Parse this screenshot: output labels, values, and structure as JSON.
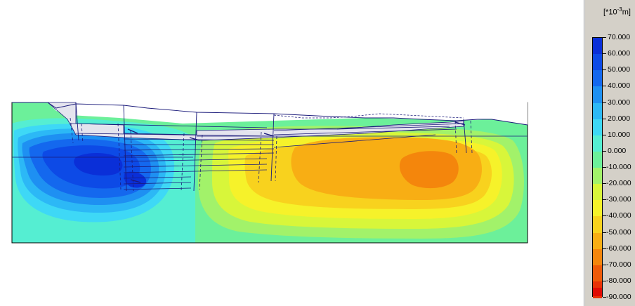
{
  "legend": {
    "unit_prefix": "[*10",
    "unit_exponent": "-3",
    "unit_suffix": "m]",
    "levels": [
      {
        "label": "70.000",
        "color": "#0a2fd8"
      },
      {
        "label": "60.000",
        "color": "#0d4ae6"
      },
      {
        "label": "50.000",
        "color": "#1468ee"
      },
      {
        "label": "40.000",
        "color": "#1e90f2"
      },
      {
        "label": "30.000",
        "color": "#2cb8f6"
      },
      {
        "label": "20.000",
        "color": "#3ed8f6"
      },
      {
        "label": "10.000",
        "color": "#55eed2"
      },
      {
        "label": "0.000",
        "color": "#6cf09a"
      },
      {
        "label": "-10.000",
        "color": "#a2f26a"
      },
      {
        "label": "-20.000",
        "color": "#d8f63a"
      },
      {
        "label": "-30.000",
        "color": "#f6f22a"
      },
      {
        "label": "-40.000",
        "color": "#f8d21e"
      },
      {
        "label": "-50.000",
        "color": "#f8ae14"
      },
      {
        "label": "-60.000",
        "color": "#f4860c"
      },
      {
        "label": "-70.000",
        "color": "#ee5a08"
      },
      {
        "label": "-80.000",
        "color": "#e83206"
      },
      {
        "label": "-90.000",
        "color": "#e00a04"
      }
    ]
  },
  "plot": {
    "background_color": "#6cf09a",
    "outline_color": "#000000",
    "structure_color": "#1a1a7a",
    "excavation_fill": "#e4e4ee"
  }
}
